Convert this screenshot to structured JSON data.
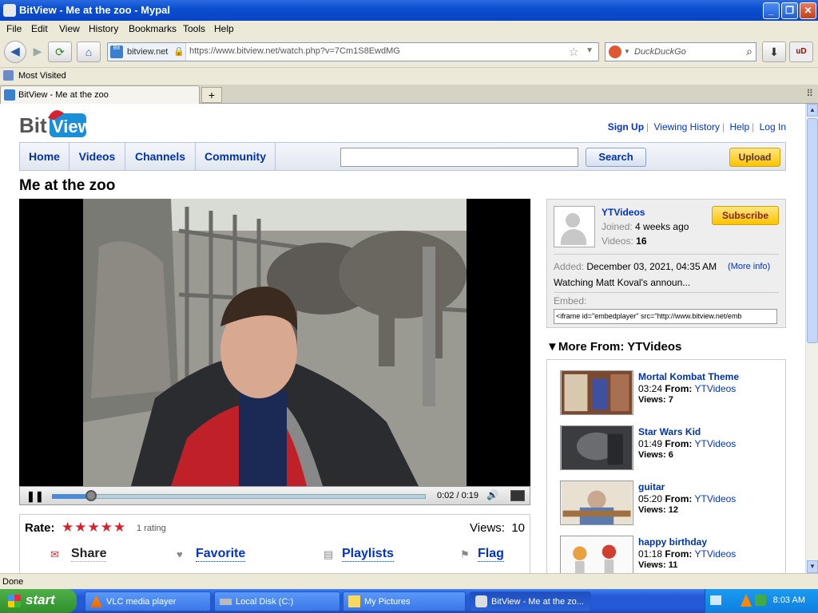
{
  "window": {
    "title": "BitView - Me at the zoo - Mypal"
  },
  "menu": [
    "File",
    "Edit",
    "View",
    "History",
    "Bookmarks",
    "Tools",
    "Help"
  ],
  "address": {
    "site": "bitview.net",
    "url": "https://www.bitview.net/watch.php?v=7Cm1S8EwdMG"
  },
  "browser_search": {
    "placeholder": "DuckDuckGo"
  },
  "bookmarks": {
    "most_visited": "Most Visited"
  },
  "tabs": [
    {
      "label": "BitView - Me at the zoo"
    }
  ],
  "page": {
    "logo": "BitView",
    "top_links": [
      "Sign Up",
      "Viewing History",
      "Help",
      "Log In"
    ],
    "nav": [
      "Home",
      "Videos",
      "Channels",
      "Community"
    ],
    "search_button": "Search",
    "upload_button": "Upload",
    "video_title": "Me at the zoo",
    "player": {
      "time": "0:02 / 0:19",
      "progress": 0.105
    },
    "rating": {
      "label": "Rate:",
      "stars": "★★★★★",
      "count": "1 rating",
      "views_label": "Views:",
      "views": "10"
    },
    "actions": [
      "Share",
      "Favorite",
      "Playlists",
      "Flag"
    ],
    "uploader": {
      "name": "YTVideos",
      "joined_label": "Joined:",
      "joined": "4 weeks ago",
      "videos_label": "Videos:",
      "videos": "16",
      "subscribe": "Subscribe",
      "added_label": "Added:",
      "added": "December 03, 2021, 04:35 AM",
      "more_info": "(More info)",
      "description": "Watching Matt Koval's announ...",
      "embed_label": "Embed:",
      "embed_code": "<iframe id=\"embedplayer\" src=\"http://www.bitview.net/emb"
    },
    "more_from": "More From: YTVideos",
    "more_videos": [
      {
        "title": "Mortal Kombat Theme",
        "duration": "03:24",
        "from_label": "From:",
        "from": "YTVideos",
        "views": "Views: 7"
      },
      {
        "title": "Star Wars Kid",
        "duration": "01:49",
        "from_label": "From:",
        "from": "YTVideos",
        "views": "Views: 6"
      },
      {
        "title": "guitar",
        "duration": "05:20",
        "from_label": "From:",
        "from": "YTVideos",
        "views": "Views: 12"
      },
      {
        "title": "happy birthday",
        "duration": "01:18",
        "from_label": "From:",
        "from": "YTVideos",
        "views": "Views: 11"
      }
    ]
  },
  "status": "Done",
  "taskbar": {
    "start": "start",
    "tasks": [
      "VLC media player",
      "Local Disk (C:)",
      "My Pictures",
      "BitView - Me at the zo..."
    ],
    "clock": "8:03 AM"
  },
  "colors": {
    "link": "#0033cc",
    "accent_yellow": "#fbc400",
    "star_red": "#d8212f"
  }
}
